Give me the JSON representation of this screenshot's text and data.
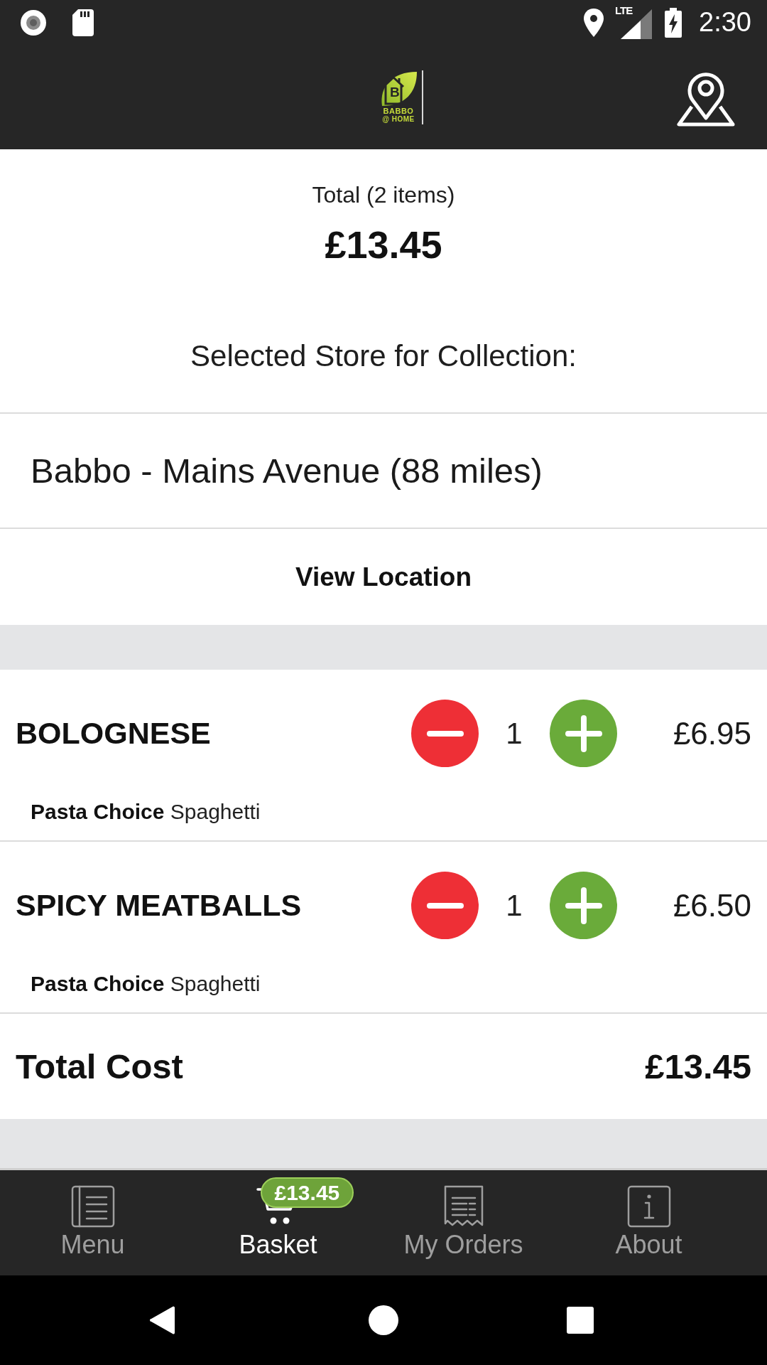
{
  "status_bar": {
    "network": "LTE",
    "time": "2:30"
  },
  "header": {
    "logo": {
      "initial": "B",
      "wordmark": "BABBO",
      "tagline": "@ HOME"
    }
  },
  "summary": {
    "label": "Total (2 items)",
    "amount": "£13.45"
  },
  "store": {
    "heading": "Selected Store for Collection:",
    "name": "Babbo - Mains Avenue (88 miles)",
    "action": "View Location"
  },
  "basket_items": [
    {
      "name": "BOLOGNESE",
      "option": "**Pasta Choice** Spaghetti",
      "quantity": "1",
      "price": "£6.95"
    },
    {
      "name": "SPICY MEATBALLS",
      "option": "**Pasta Choice** Spaghetti",
      "quantity": "1",
      "price": "£6.50"
    }
  ],
  "total": {
    "label": "Total Cost",
    "amount": "£13.45"
  },
  "bottom_nav": {
    "items": [
      {
        "kind": "menu",
        "label": "Menu",
        "selected": false
      },
      {
        "kind": "basket",
        "label": "Basket",
        "selected": true,
        "badge": "£13.45"
      },
      {
        "kind": "orders",
        "label": "My Orders",
        "selected": false
      },
      {
        "kind": "about",
        "label": "About",
        "selected": false
      }
    ]
  }
}
